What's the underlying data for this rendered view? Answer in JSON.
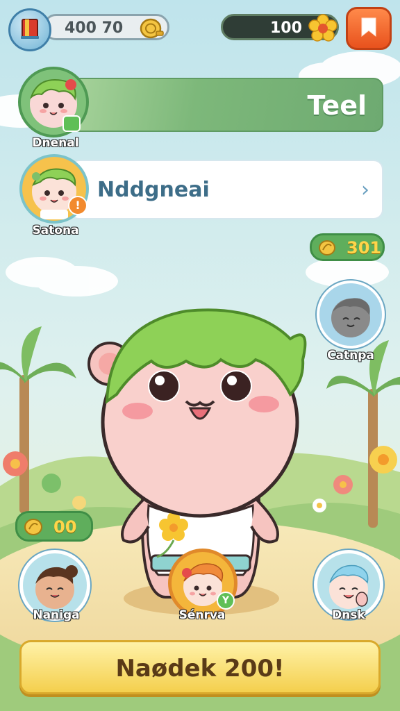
{
  "resources": {
    "coins": "400 70",
    "flowers": "100"
  },
  "friends": [
    {
      "name": "Dnenal",
      "title": "Teel"
    },
    {
      "name": "Satona",
      "title": "Nddgneai"
    }
  ],
  "seeds_top": "301",
  "seeds_bottom": "00",
  "characters": [
    {
      "name": "Catnpa"
    },
    {
      "name": "Naniga"
    },
    {
      "name": "Sénrva"
    },
    {
      "name": "Dnsk"
    }
  ],
  "cta": {
    "label": "Naødek 200!"
  },
  "colors": {
    "sky": "#bfe3ea",
    "green_bar": "#7db87a",
    "cta_yellow": "#f4cf4d",
    "orange_button": "#e8521d"
  }
}
